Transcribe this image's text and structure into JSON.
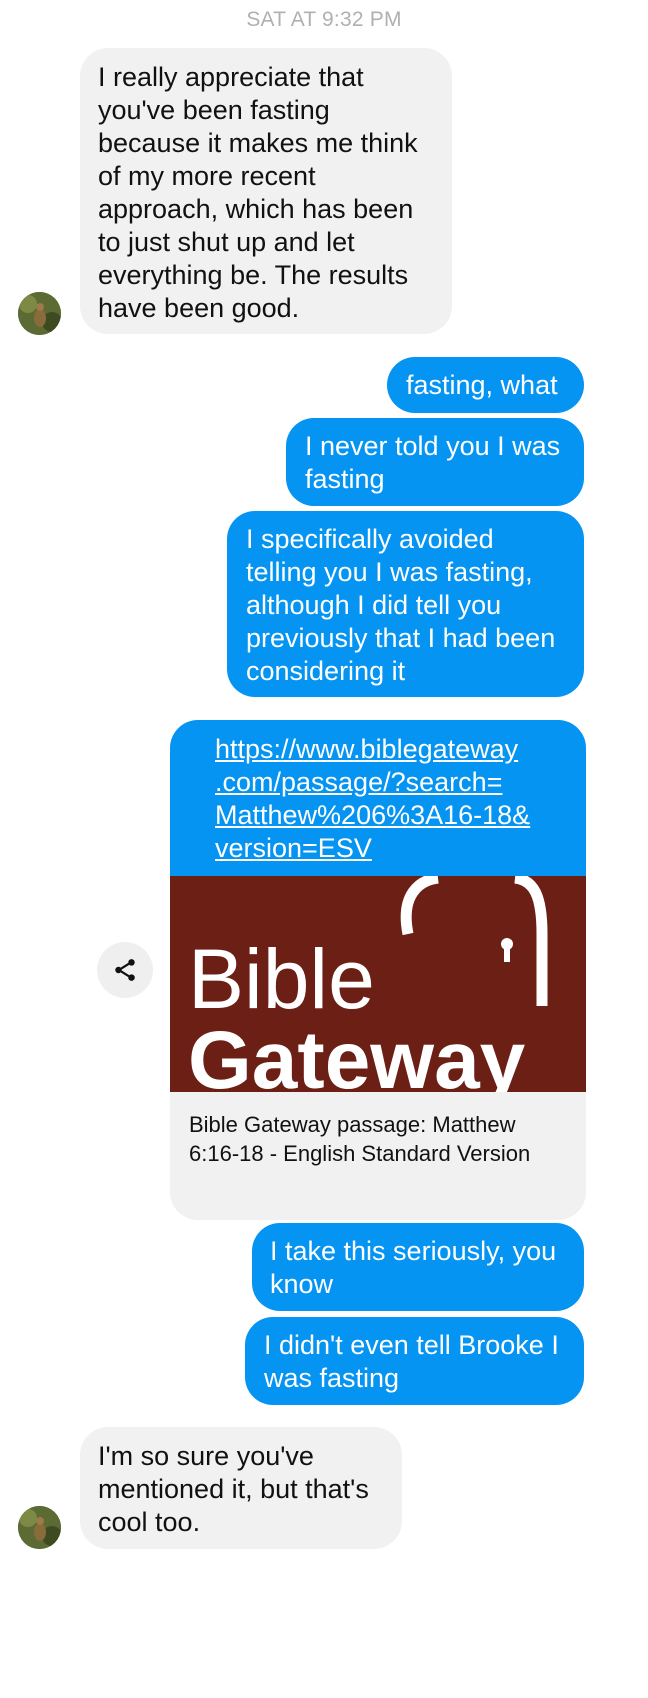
{
  "header": {
    "timestamp": "SAT AT 9:32 PM"
  },
  "messages": [
    {
      "sender": "them",
      "text": "I really appreciate that\nyou've been fasting\nbecause it makes me think\nof my more recent\napproach, which has been\nto just shut up and let\neverything be. The results\nhave been good."
    },
    {
      "sender": "me",
      "text": "fasting, what"
    },
    {
      "sender": "me",
      "text": "I never told you I was\nfasting"
    },
    {
      "sender": "me",
      "text": "I specifically avoided\ntelling you I was fasting,\nalthough I did tell you\npreviously that I had been\nconsidering it"
    },
    {
      "sender": "me",
      "text": "I take this seriously, you\nknow"
    },
    {
      "sender": "me",
      "text": "I didn't even tell Brooke I\nwas fasting"
    },
    {
      "sender": "them",
      "text": "I'm so sure you've\nmentioned it, but that's\ncool too."
    }
  ],
  "link_preview": {
    "url": "https://www.biblegateway\n.com/passage/?search=\nMatthew%206%3A16-18&\nversion=ESV",
    "logo_line1": "Bible",
    "logo_line2": "Gateway",
    "title": "Bible Gateway passage: Matthew 6:16-18 - English Standard Version"
  },
  "icons": {
    "share": "share-icon",
    "avatar": "contact-avatar"
  },
  "colors": {
    "outgoing": "#0594f2",
    "incoming": "#f1f1f1",
    "logo_bg": "#6b1f15"
  }
}
